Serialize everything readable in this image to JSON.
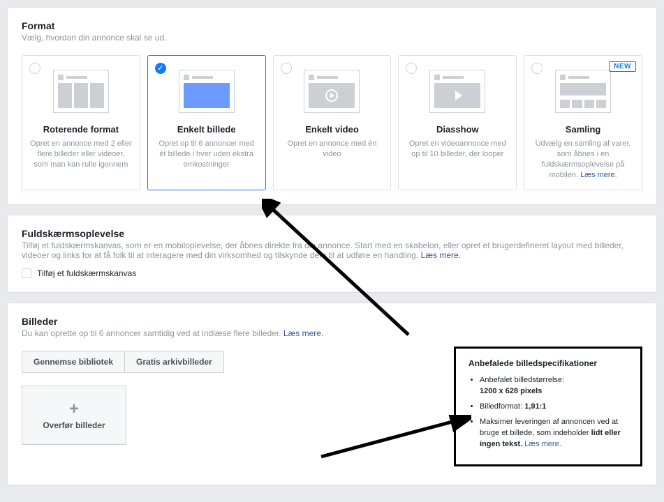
{
  "format": {
    "title": "Format",
    "subtitle": "Vælg, hvordan din annonce skal se ud.",
    "new_label": "NEW",
    "laes_mere": "Læs mere",
    "cards": [
      {
        "title": "Roterende format",
        "desc": "Opret en annonce med 2 eller flere billeder eller videoer, som man kan rulle igennem"
      },
      {
        "title": "Enkelt billede",
        "desc": "Opret op til 6 annoncer med ét billede i hver uden ekstra omkostninger"
      },
      {
        "title": "Enkelt video",
        "desc": "Opret en annonce med én video"
      },
      {
        "title": "Diasshow",
        "desc": "Opret en videoannonce med op til 10 billeder, der looper"
      },
      {
        "title": "Samling",
        "desc": "Udvælg en samling af varer, som åbnes i en fuldskærmsoplevelse på mobilen. "
      }
    ]
  },
  "fullscreen": {
    "title": "Fuldskærmsoplevelse",
    "desc": "Tilføj et fuldskærmskanvas, som er en mobiloplevelse, der åbnes direkte fra din annonce. Start med en skabelon, eller opret et brugerdefineret layout med billeder, videoer og links for at få folk til at interagere med din virksomhed og tilskynde dem til at udføre en handling. ",
    "laes_mere": "Læs mere.",
    "checkbox": "Tilføj et fuldskærmskanvas"
  },
  "images": {
    "title": "Billeder",
    "desc": "Du kan oprette op til 6 annoncer samtidig ved at indlæse flere billeder. ",
    "laes_mere": "Læs mere.",
    "btn_library": "Gennemse bibliotek",
    "btn_stock": "Gratis arkivbilleder",
    "upload": "Overfør billeder",
    "specs": {
      "heading": "Anbefalede billedspecifikationer",
      "item1_label": "Anbefalet billedstørrelse:",
      "item1_value": "1200 x 628 pixels",
      "item2_label": "Billedformat: ",
      "item2_value": "1,91:1",
      "item3_a": "Maksimer leveringen af annoncen ved at bruge et billede, som indeholder ",
      "item3_b": "lidt eller ingen tekst.",
      "item3_link": "Læs mere."
    }
  }
}
